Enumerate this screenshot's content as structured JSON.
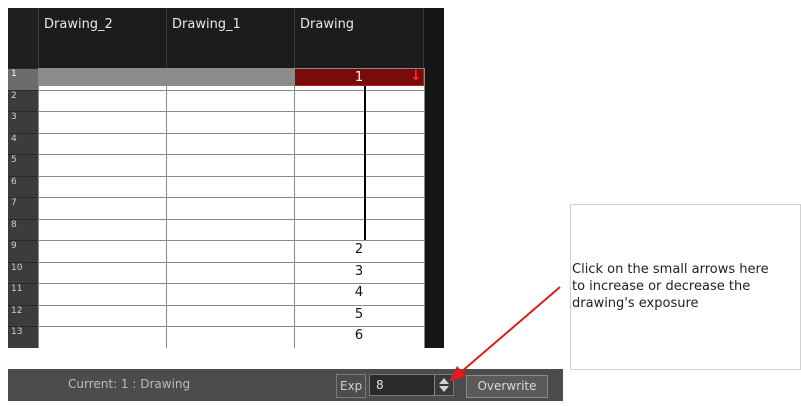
{
  "columns": [
    {
      "name": "Drawing_2"
    },
    {
      "name": "Drawing_1"
    },
    {
      "name": "Drawing"
    }
  ],
  "rows": [
    "1",
    "2",
    "3",
    "4",
    "5",
    "6",
    "7",
    "8",
    "9",
    "10",
    "11",
    "12",
    "13"
  ],
  "drawing_column_values": [
    {
      "row": 1,
      "value": "1"
    },
    {
      "row": 9,
      "value": "2"
    },
    {
      "row": 10,
      "value": "3"
    },
    {
      "row": 11,
      "value": "4"
    },
    {
      "row": 12,
      "value": "5"
    },
    {
      "row": 13,
      "value": "6"
    }
  ],
  "toolbar": {
    "current": "Current: 1 : Drawing",
    "exp_label": "Exp",
    "exp_value": "8",
    "overwrite_label": "Overwrite"
  },
  "callout": {
    "lines": [
      "Click on the small arrows here",
      "to increase or decrease the",
      "drawing's exposure"
    ]
  },
  "colors": {
    "selection_red": "#7a0b0b",
    "arrow_red": "#ff2a2a"
  },
  "icons": {
    "hold_arrow": "red-down-arrow-icon",
    "spinner": "spinner-arrows-icon"
  }
}
